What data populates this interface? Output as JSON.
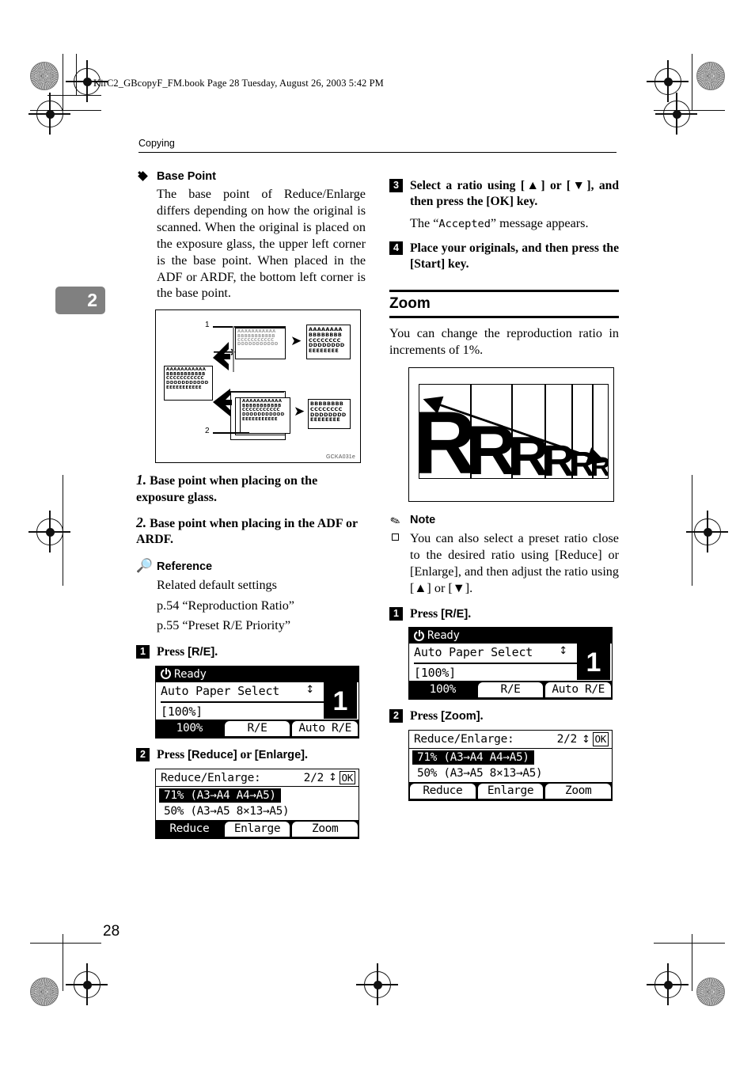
{
  "page": {
    "book_header": "KirC2_GBcopyF_FM.book  Page 28  Tuesday, August 26, 2003  5:42 PM",
    "running_head": "Copying",
    "chapter_tab": "2",
    "page_number": "28"
  },
  "left_column": {
    "base_point": {
      "heading": "Base Point",
      "body": "The base point of Reduce/Enlarge differs depending on how the original is scanned. When the original is placed on the exposure glass, the upper left corner is the base point. When placed in the ADF or ARDF, the bottom left corner is the base point."
    },
    "figure": {
      "id": "GCKA031e",
      "callout_1": "1",
      "callout_2": "2",
      "source_rows": [
        "AAAAAAAAAAA",
        "BBBBBBBBBBB",
        "CCCCCCCCCCC",
        "DDDDDDDDDDD",
        "EEEEEEEEEEE"
      ],
      "scan_top_rows": [
        "AAAAAAAAAAA",
        "BBBBBBBBBBB",
        "CCCCCCCCCCC",
        "DDDDDDDDDDD"
      ],
      "out_top_rows": [
        "AAAAAAAA",
        "BBBBBBBB",
        "CCCCCCCC",
        "DDDDDDDD",
        "EEEEEEEE"
      ],
      "scan_bottom_rows": [
        "AAAAAAAAAAA",
        "BBBBBBBBBBB",
        "CCCCCCCCCCC",
        "DDDDDDDDDDD",
        "EEEEEEEEEEE"
      ],
      "out_bottom_rows": [
        "BBBBBBBB",
        "CCCCCCCC",
        "DDDDDDDD",
        "EEEEEEEE"
      ]
    },
    "caption_1_num": "1.",
    "caption_1": "Base point when placing on the exposure glass.",
    "caption_2_num": "2.",
    "caption_2": "Base point when placing in the ADF or ARDF.",
    "reference": {
      "heading": "Reference",
      "line1": "Related default settings",
      "line2": "p.54 “Reproduction Ratio”",
      "line3": "p.55 “Preset R/E Priority”"
    },
    "step1": {
      "num": "1",
      "text_before": "Press ",
      "key": "[R/E]",
      "text_after": "."
    },
    "lcd1": {
      "status": "Ready",
      "row1": "Auto Paper Select",
      "updown": "↕",
      "row2": "[100%]",
      "copies": "1",
      "softkeys": [
        {
          "label": "100%",
          "selected": true
        },
        {
          "label": "R/E",
          "selected": false
        },
        {
          "label": "Auto R/E",
          "selected": false
        }
      ]
    },
    "step2": {
      "num": "2",
      "text_before": "Press ",
      "key1": "[Reduce]",
      "text_mid": " or ",
      "key2": "[Enlarge]",
      "text_after": "."
    },
    "lcd2": {
      "title": "Reduce/Enlarge:",
      "page_indicator": "2/2",
      "updown": "↕",
      "ok_label": "OK",
      "items": [
        {
          "label": "71% (A3→A4 A4→A5)",
          "selected": true
        },
        {
          "label": "50% (A3→A5 8×13→A5)",
          "selected": false
        }
      ],
      "softkeys": [
        {
          "label": "Reduce",
          "selected": true
        },
        {
          "label": "Enlarge",
          "selected": false
        },
        {
          "label": "Zoom",
          "selected": false
        }
      ]
    }
  },
  "right_column": {
    "step3": {
      "num": "3",
      "line": "Select a ratio using [▲] or [▼], and then press the [OK] key.",
      "sub_before": "The “",
      "sub_mono": "Accepted",
      "sub_after": "” message appears."
    },
    "step4": {
      "num": "4",
      "line": "Place your originals, and then press the [Start] key."
    },
    "zoom_section": {
      "title": "Zoom",
      "body": "You can change the reproduction ratio in increments of 1%."
    },
    "zoom_figure": {
      "letters": [
        "R",
        "R",
        "R",
        "R",
        "R",
        "R"
      ]
    },
    "note": {
      "heading": "Note",
      "bullet": "You can also select a preset ratio close to the desired ratio using [Reduce] or [Enlarge], and then adjust the ratio using [▲] or [▼]."
    },
    "step1": {
      "num": "1",
      "text_before": "Press ",
      "key": "[R/E]",
      "text_after": "."
    },
    "lcd1": {
      "status": "Ready",
      "row1": "Auto Paper Select",
      "updown": "↕",
      "row2": "[100%]",
      "copies": "1",
      "softkeys": [
        {
          "label": "100%",
          "selected": true
        },
        {
          "label": "R/E",
          "selected": false
        },
        {
          "label": "Auto R/E",
          "selected": false
        }
      ]
    },
    "step2": {
      "num": "2",
      "text_before": "Press ",
      "key": "[Zoom]",
      "text_after": "."
    },
    "lcd2": {
      "title": "Reduce/Enlarge:",
      "page_indicator": "2/2",
      "updown": "↕",
      "ok_label": "OK",
      "items": [
        {
          "label": "71% (A3→A4 A4→A5)",
          "selected": true
        },
        {
          "label": "50% (A3→A5 8×13→A5)",
          "selected": false
        }
      ],
      "softkeys": [
        {
          "label": "Reduce",
          "selected": false
        },
        {
          "label": "Enlarge",
          "selected": false
        },
        {
          "label": "Zoom",
          "selected": false
        }
      ]
    }
  }
}
